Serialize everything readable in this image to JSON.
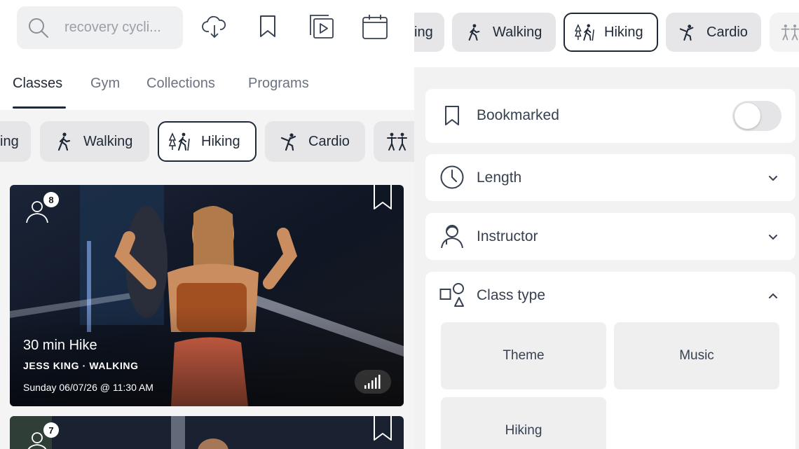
{
  "search": {
    "placeholder": "recovery cycli..."
  },
  "toolbar": {
    "icons": [
      "download-cloud-icon",
      "bookmark-icon",
      "playlist-icon",
      "calendar-icon"
    ]
  },
  "tabs": [
    {
      "label": "Classes",
      "active": true
    },
    {
      "label": "Gym",
      "active": false
    },
    {
      "label": "Collections",
      "active": false
    },
    {
      "label": "Programs",
      "active": false
    }
  ],
  "chips": [
    {
      "label": "ing",
      "icon": "",
      "selected": false
    },
    {
      "label": "Walking",
      "icon": "walking-icon",
      "selected": false
    },
    {
      "label": "Hiking",
      "icon": "hiking-icon",
      "selected": true
    },
    {
      "label": "Cardio",
      "icon": "cardio-icon",
      "selected": false
    },
    {
      "label": "",
      "icon": "strength-icon",
      "selected": false
    }
  ],
  "cards": [
    {
      "title": "30 min Hike",
      "subtitle": "JESS KING · WALKING",
      "date": "Sunday 06/07/26 @ 11:30 AM",
      "participants": "8",
      "difficulty_icon": "signal-bars-icon"
    },
    {
      "participants": "7"
    }
  ],
  "right_chips": [
    {
      "label": "ing",
      "selected": false
    },
    {
      "label": "Walking",
      "selected": false
    },
    {
      "label": "Hiking",
      "selected": true
    },
    {
      "label": "Cardio",
      "selected": false
    },
    {
      "label": "",
      "selected": false
    }
  ],
  "filters": {
    "bookmarked": {
      "label": "Bookmarked",
      "on": false
    },
    "length": {
      "label": "Length"
    },
    "instructor": {
      "label": "Instructor"
    },
    "class_type": {
      "label": "Class type",
      "expanded": true,
      "options": [
        "Theme",
        "Music",
        "Hiking"
      ]
    }
  }
}
